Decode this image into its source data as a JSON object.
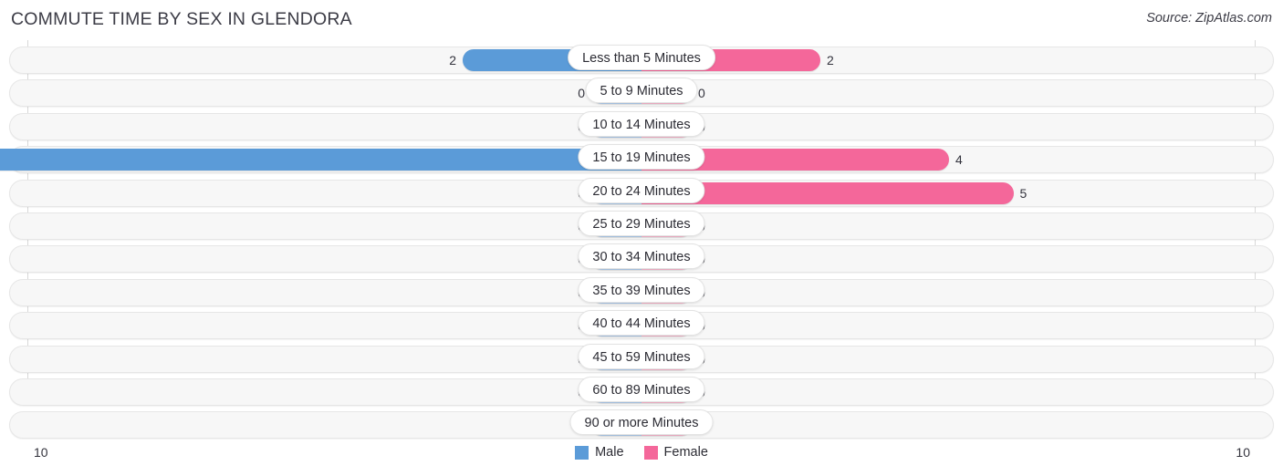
{
  "header": {
    "title": "COMMUTE TIME BY SEX IN GLENDORA",
    "source": "Source: ZipAtlas.com"
  },
  "axis": {
    "left_label": "10",
    "right_label": "10",
    "max": 10
  },
  "legend": {
    "items": [
      {
        "label": "Male",
        "color": "#5b9bd8"
      },
      {
        "label": "Female",
        "color": "#f4679a"
      }
    ]
  },
  "colors": {
    "male_strong": "#5b9bd8",
    "male_light": "#aecbeb",
    "female_strong": "#f4679a",
    "female_light": "#f7b4cb",
    "track": "#f7f7f7",
    "track_border": "#e6e6e6"
  },
  "chart_data": {
    "type": "bar",
    "title": "COMMUTE TIME BY SEX IN GLENDORA",
    "subtype": "diverging-bidirectional",
    "xlabel": "",
    "ylabel": "",
    "xlim": [
      10,
      10
    ],
    "grid": false,
    "legend_position": "bottom-center",
    "categories": [
      "Less than 5 Minutes",
      "5 to 9 Minutes",
      "10 to 14 Minutes",
      "15 to 19 Minutes",
      "20 to 24 Minutes",
      "25 to 29 Minutes",
      "30 to 34 Minutes",
      "35 to 39 Minutes",
      "40 to 44 Minutes",
      "45 to 59 Minutes",
      "60 to 89 Minutes",
      "90 or more Minutes"
    ],
    "series": [
      {
        "name": "Male",
        "values": [
          2,
          0,
          0,
          10,
          0,
          0,
          0,
          0,
          0,
          0,
          0,
          0
        ]
      },
      {
        "name": "Female",
        "values": [
          2,
          0,
          0,
          4,
          5,
          0,
          0,
          0,
          0,
          0,
          0,
          0
        ]
      }
    ]
  },
  "rows": [
    {
      "label": "Less than 5 Minutes",
      "male": "2",
      "female": "2"
    },
    {
      "label": "5 to 9 Minutes",
      "male": "0",
      "female": "0"
    },
    {
      "label": "10 to 14 Minutes",
      "male": "0",
      "female": "0"
    },
    {
      "label": "15 to 19 Minutes",
      "male": "10",
      "female": "4"
    },
    {
      "label": "20 to 24 Minutes",
      "male": "0",
      "female": "5"
    },
    {
      "label": "25 to 29 Minutes",
      "male": "0",
      "female": "0"
    },
    {
      "label": "30 to 34 Minutes",
      "male": "0",
      "female": "0"
    },
    {
      "label": "35 to 39 Minutes",
      "male": "0",
      "female": "0"
    },
    {
      "label": "40 to 44 Minutes",
      "male": "0",
      "female": "0"
    },
    {
      "label": "45 to 59 Minutes",
      "male": "0",
      "female": "0"
    },
    {
      "label": "60 to 89 Minutes",
      "male": "0",
      "female": "0"
    },
    {
      "label": "90 or more Minutes",
      "male": "0",
      "female": "0"
    }
  ]
}
